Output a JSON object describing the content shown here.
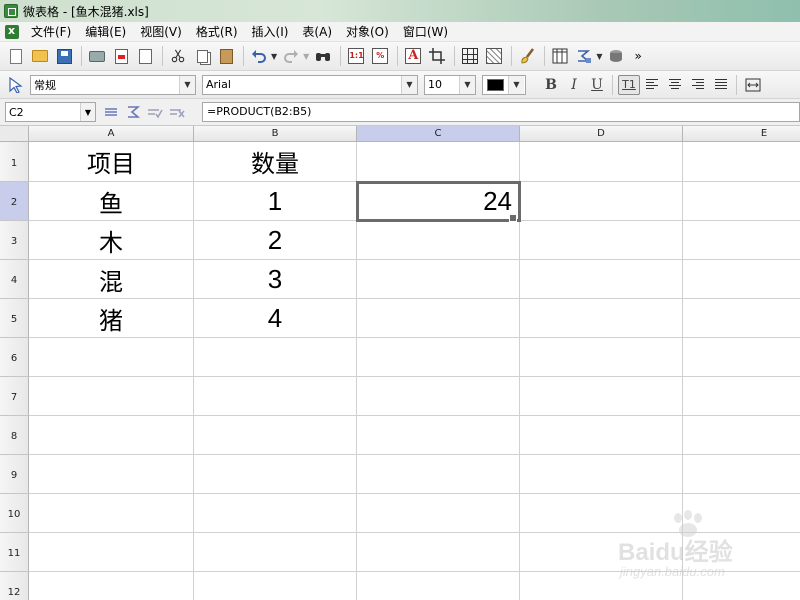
{
  "window": {
    "title": "微表格 - [鱼木混猪.xls]"
  },
  "menu": {
    "items": [
      "文件(F)",
      "编辑(E)",
      "视图(V)",
      "格式(R)",
      "插入(I)",
      "表(A)",
      "对象(O)",
      "窗口(W)"
    ]
  },
  "toolbar": {
    "overflow_label": "»",
    "box_ratio": "1:1",
    "box_percent": "%",
    "box_text": "A"
  },
  "format_bar": {
    "style_value": "常规",
    "font_value": "Arial",
    "size_value": "10",
    "text_color": "#000000",
    "bold": "B",
    "italic": "I",
    "underline": "U",
    "wrap": "T1"
  },
  "formula_bar": {
    "cell_ref": "C2",
    "formula": "=PRODUCT(B2:B5)"
  },
  "sheet": {
    "columns": [
      "A",
      "B",
      "C",
      "D",
      "E"
    ],
    "selected_column": "C",
    "rows": [
      "1",
      "2",
      "3",
      "4",
      "5",
      "6",
      "7",
      "8",
      "9",
      "10",
      "11",
      "12"
    ],
    "selected_row": "2",
    "cells": {
      "A1": "项目",
      "B1": "数量",
      "A2": "鱼",
      "B2": "1",
      "C2": "24",
      "A3": "木",
      "B3": "2",
      "A4": "混",
      "B4": "3",
      "A5": "猪",
      "B5": "4"
    },
    "selected_cell": "C2"
  },
  "watermark": {
    "brand": "Baidu经验",
    "url": "jingyan.baidu.com"
  }
}
